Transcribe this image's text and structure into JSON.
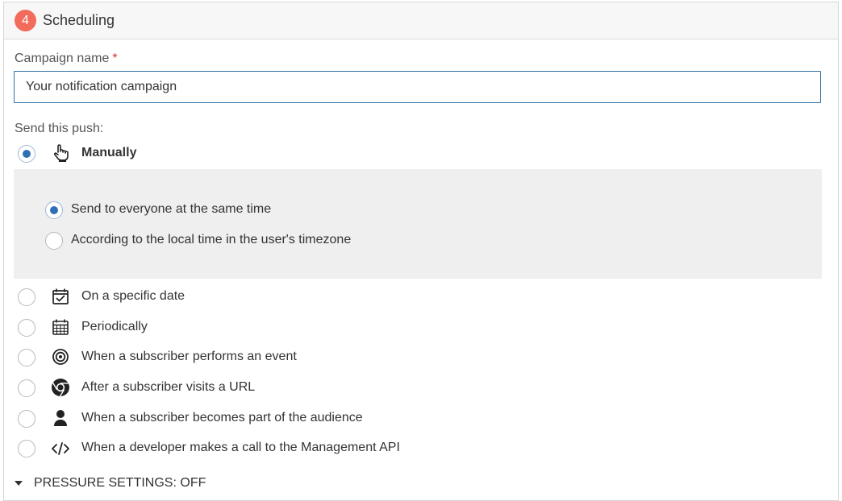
{
  "header": {
    "step_number": "4",
    "title": "Scheduling"
  },
  "campaign_name": {
    "label": "Campaign name",
    "required_mark": "*",
    "value": "Your notification campaign"
  },
  "send_push_label": "Send this push:",
  "options": [
    {
      "label": "Manually",
      "icon": "hand-pointer-icon",
      "selected": true
    },
    {
      "label": "On a specific date",
      "icon": "calendar-check-icon",
      "selected": false
    },
    {
      "label": "Periodically",
      "icon": "calendar-grid-icon",
      "selected": false
    },
    {
      "label": "When a subscriber performs an event",
      "icon": "target-icon",
      "selected": false
    },
    {
      "label": "After a subscriber visits a URL",
      "icon": "chrome-icon",
      "selected": false
    },
    {
      "label": "When a subscriber becomes part of the audience",
      "icon": "user-icon",
      "selected": false
    },
    {
      "label": "When a developer makes a call to the Management API",
      "icon": "code-icon",
      "selected": false
    }
  ],
  "manual_suboptions": [
    {
      "label": "Send to everyone at the same time",
      "selected": true
    },
    {
      "label": "According to the local time in the user's timezone",
      "selected": false
    }
  ],
  "pressure_settings": {
    "label": "PRESSURE SETTINGS: OFF"
  },
  "colors": {
    "accent": "#2f6fb3",
    "badge": "#f26b5b",
    "input_border": "#2f6fa6",
    "suboptions_bg": "#efefef"
  }
}
